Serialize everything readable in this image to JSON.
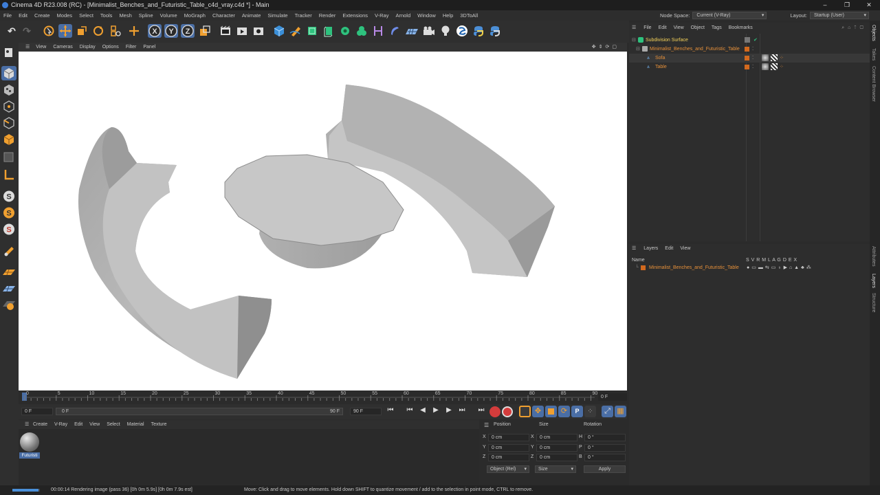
{
  "window": {
    "title": "Cinema 4D R23.008 (RC) - [Minimalist_Benches_and_Futuristic_Table_c4d_vray.c4d *] - Main",
    "controls": [
      "–",
      "❐",
      "✕"
    ]
  },
  "menubar": {
    "items": [
      "File",
      "Edit",
      "Create",
      "Modes",
      "Select",
      "Tools",
      "Mesh",
      "Spline",
      "Volume",
      "MoGraph",
      "Character",
      "Animate",
      "Simulate",
      "Tracker",
      "Render",
      "Extensions",
      "V-Ray",
      "Arnold",
      "Window",
      "Help",
      "3DToAll"
    ],
    "node_space_label": "Node Space:",
    "node_space_value": "Current (V-Ray)",
    "layout_label": "Layout:",
    "layout_value": "Startup (User)"
  },
  "toolbar": {
    "axis_x": "X",
    "axis_y": "Y",
    "axis_z": "Z"
  },
  "viewport": {
    "menu": [
      "View",
      "Cameras",
      "Display",
      "Options",
      "Filter",
      "Panel"
    ]
  },
  "timeline": {
    "ticks": [
      "0",
      "5",
      "10",
      "15",
      "20",
      "25",
      "30",
      "35",
      "40",
      "45",
      "50",
      "55",
      "60",
      "65",
      "70",
      "75",
      "80",
      "85",
      "90"
    ],
    "current_frame": "0 F",
    "start_field": "0 F",
    "range_start": "0 F",
    "range_end": "90 F",
    "end_field": "90 F"
  },
  "material_manager": {
    "menu": [
      "Create",
      "V-Ray",
      "Edit",
      "View",
      "Select",
      "Material",
      "Texture"
    ],
    "material_name": "Futuristi"
  },
  "coordinates": {
    "headers": [
      "Position",
      "Size",
      "Rotation"
    ],
    "rows": [
      {
        "axis": "X",
        "pos": "0 cm",
        "saxis": "X",
        "size": "0 cm",
        "raxis": "H",
        "rot": "0 °"
      },
      {
        "axis": "Y",
        "pos": "0 cm",
        "saxis": "Y",
        "size": "0 cm",
        "raxis": "P",
        "rot": "0 °"
      },
      {
        "axis": "Z",
        "pos": "0 cm",
        "saxis": "Z",
        "size": "0 cm",
        "raxis": "B",
        "rot": "0 °"
      }
    ],
    "mode": "Object (Rel)",
    "size_mode": "Size",
    "apply": "Apply"
  },
  "object_manager": {
    "menu": [
      "File",
      "Edit",
      "View",
      "Object",
      "Tags",
      "Bookmarks"
    ],
    "objects": [
      {
        "name": "Subdivision Surface"
      },
      {
        "name": "Minimalist_Benches_and_Futuristic_Table"
      },
      {
        "name": "Sofa"
      },
      {
        "name": "Table"
      }
    ]
  },
  "layer_manager": {
    "menu": [
      "Layers",
      "Edit",
      "View"
    ],
    "name_header": "Name",
    "flags": "S V R M L A G D E X",
    "layer_name": "Minimalist_Benches_and_Futuristic_Table"
  },
  "side_tabs": [
    "Objects",
    "Takes",
    "Content Browser",
    "Attributes",
    "Layers",
    "Structure"
  ],
  "status": {
    "render": "00:00:14 Rendering image (pass 36) [0h  0m  5.9s] [0h  0m  7.9s est]",
    "hint": "Move: Click and drag to move elements. Hold down SHIFT to quantize movement / add to the selection in point mode, CTRL to remove."
  }
}
